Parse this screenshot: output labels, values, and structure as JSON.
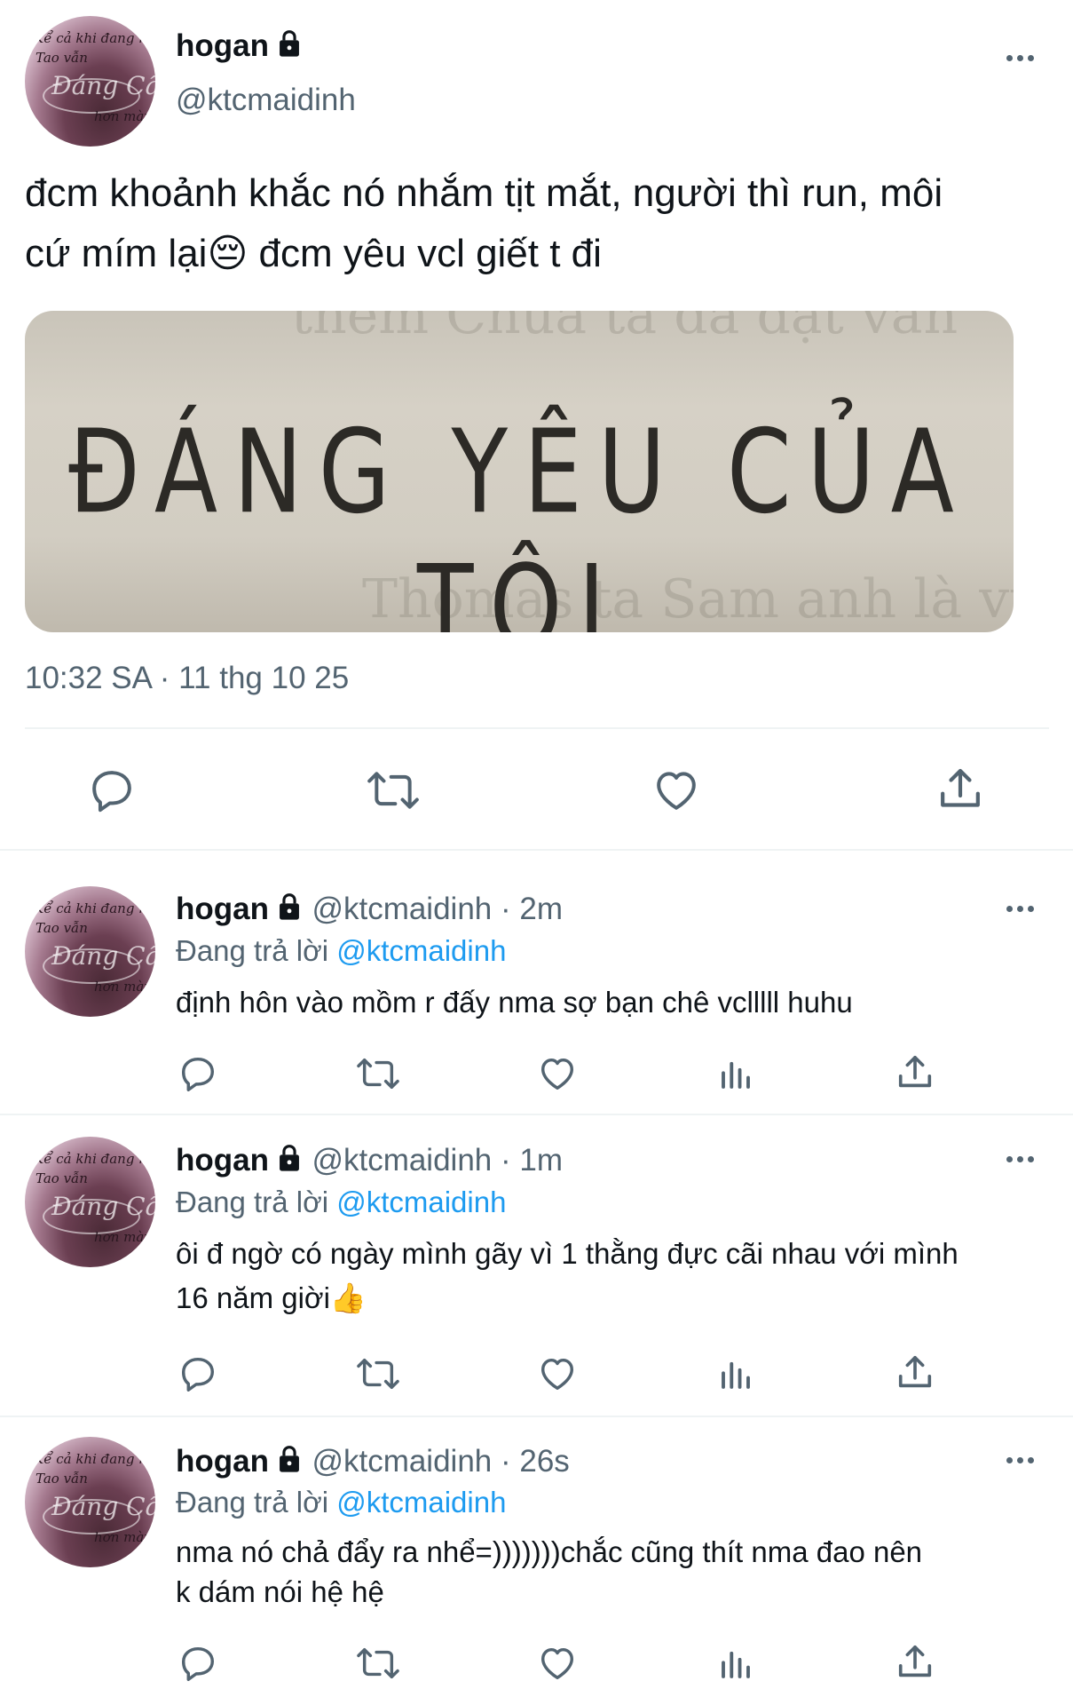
{
  "main_tweet": {
    "name": "hogan",
    "handle": "@ktcmaidinh",
    "text_line1": "đcm khoảnh khắc nó nhắm tịt mắt, người thì run, môi",
    "text_line2": "cứ mím lại😔 đcm yêu vcl giết t đi",
    "image_text": "ĐÁNG YÊU CỦA TÔI",
    "timestamp": "10:32 SA · 11 thg 10 25"
  },
  "reply_label": "Đang trả lời",
  "replies": [
    {
      "name": "hogan",
      "handle_time": "@ktcmaidinh · 2m",
      "reply_to": "@ktcmaidinh",
      "text_line1": "định hôn vào mồm r đấy nma sợ bạn chê vclllll huhu",
      "text_line2": ""
    },
    {
      "name": "hogan",
      "handle_time": "@ktcmaidinh · 1m",
      "reply_to": "@ktcmaidinh",
      "text_line1": "ôi đ ngờ có ngày mình gãy vì 1 thằng đực cãi nhau với mình",
      "text_line2": "16 năm giời👍"
    },
    {
      "name": "hogan",
      "handle_time": "@ktcmaidinh · 26s",
      "reply_to": "@ktcmaidinh",
      "text_line1": "nma nó chả đẩy ra nhể=)))))))chắc cũng thít nma đao nên",
      "text_line2": "k dám nói hệ hệ"
    }
  ],
  "avatar_text": {
    "line1": "Kể cả khi đang ngủ",
    "line2": "Tao vẫn",
    "line3": "Đáng Cấp",
    "line4": "hơn mày"
  },
  "colors": {
    "text": "#0f1419",
    "secondary": "#536471",
    "link": "#1d9bf0",
    "divider": "#eff3f4"
  }
}
